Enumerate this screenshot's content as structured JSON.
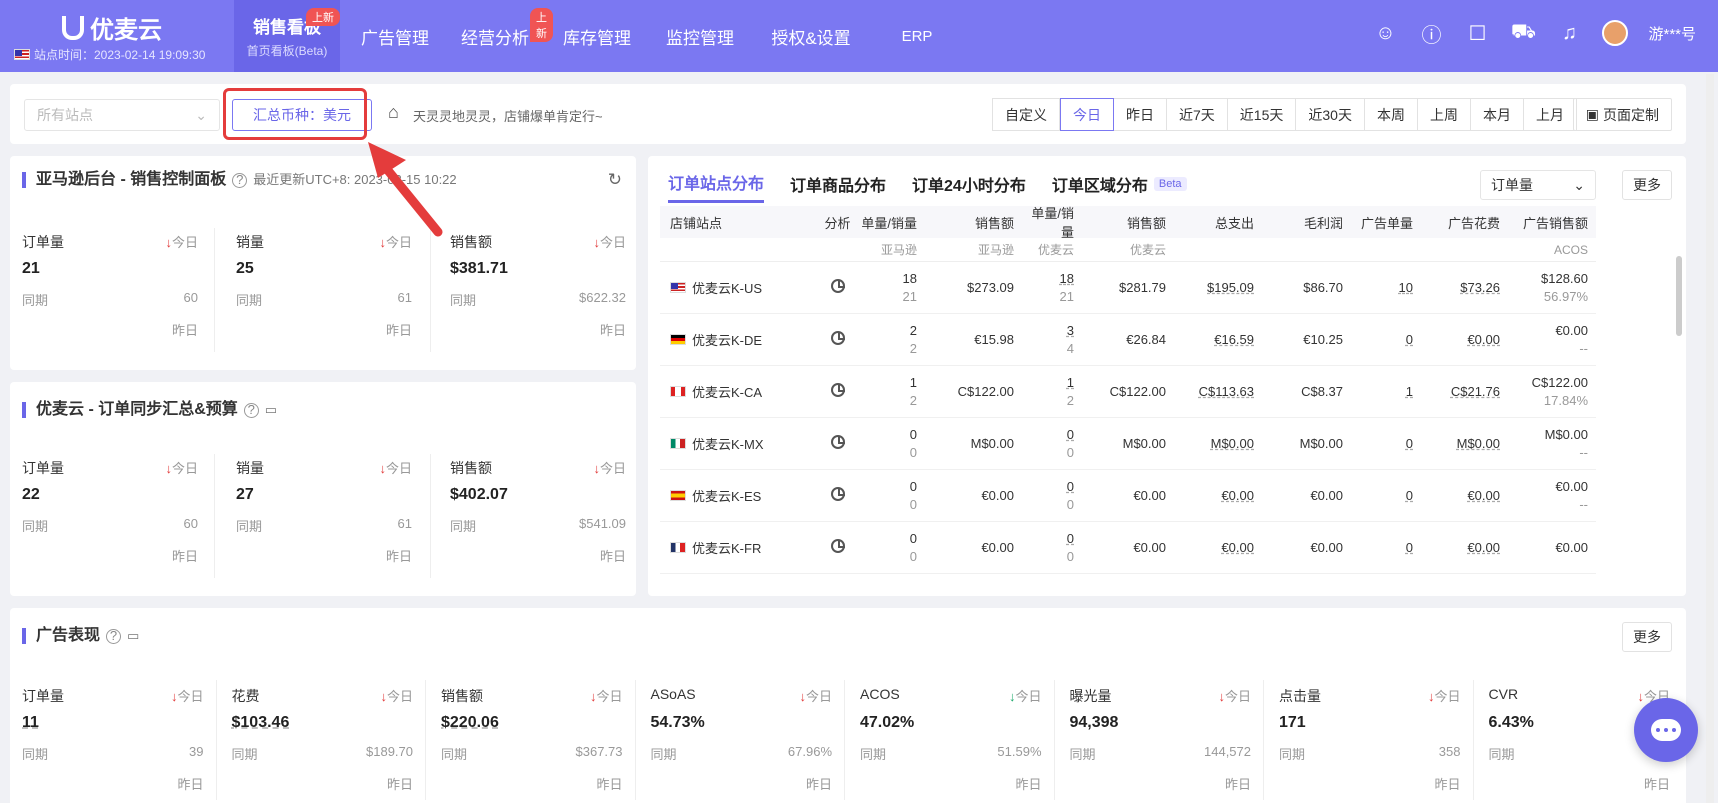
{
  "nav": {
    "logo": "优麦云",
    "site_time": "站点时间：2023-02-14 19:09:30",
    "items": [
      {
        "label": "销售看板",
        "sub": "首页看板(Beta)",
        "badge": "上新"
      },
      {
        "label": "广告管理"
      },
      {
        "label": "经营分析",
        "badge": "上新"
      },
      {
        "label": "库存管理"
      },
      {
        "label": "监控管理"
      },
      {
        "label": "授权&设置"
      },
      {
        "label": "ERP"
      }
    ],
    "user": "游***号"
  },
  "filter": {
    "site_placeholder": "所有站点",
    "currency": "汇总币种：美元",
    "slogan": "天灵灵地灵灵，店铺爆单肯定行~",
    "dates": [
      "自定义",
      "今日",
      "昨日",
      "近7天",
      "近15天",
      "近30天",
      "本周",
      "上周",
      "本月",
      "上月"
    ],
    "active_date": "今日",
    "page_custom": "页面定制"
  },
  "amazon": {
    "title": "亚马逊后台 - 销售控制面板",
    "updated": "最近更新UTC+8: 2023-02-15 10:22",
    "metrics": [
      {
        "label": "订单量",
        "trend": "今日",
        "value": "21",
        "same_label": "同期",
        "same": "60",
        "yest": "昨日"
      },
      {
        "label": "销量",
        "trend": "今日",
        "value": "25",
        "same_label": "同期",
        "same": "61",
        "yest": "昨日"
      },
      {
        "label": "销售额",
        "trend": "今日",
        "value": "$381.71",
        "same_label": "同期",
        "same": "$622.32",
        "yest": "昨日"
      }
    ]
  },
  "sync": {
    "title": "优麦云 - 订单同步汇总&预算",
    "metrics": [
      {
        "label": "订单量",
        "trend": "今日",
        "value": "22",
        "same_label": "同期",
        "same": "60",
        "yest": "昨日"
      },
      {
        "label": "销量",
        "trend": "今日",
        "value": "27",
        "same_label": "同期",
        "same": "61",
        "yest": "昨日"
      },
      {
        "label": "销售额",
        "trend": "今日",
        "value": "$402.07",
        "same_label": "同期",
        "same": "$541.09",
        "yest": "昨日"
      }
    ]
  },
  "orders": {
    "tabs": [
      "订单站点分布",
      "订单商品分布",
      "订单24小时分布",
      "订单区域分布"
    ],
    "beta": "Beta",
    "select": "订单量",
    "more": "更多",
    "headers": [
      "店铺站点",
      "分析",
      "单量/销量",
      "销售额",
      "单量/销量",
      "销售额",
      "总支出",
      "毛利润",
      "广告单量",
      "广告花费",
      "广告销售额"
    ],
    "subheaders": [
      "",
      "",
      "亚马逊",
      "亚马逊",
      "优麦云",
      "优麦云",
      "",
      "",
      "",
      "",
      "ACOS"
    ],
    "rows": [
      {
        "flag": "us",
        "store": "优麦云K-US",
        "q1a": "18",
        "q1b": "21",
        "amz": "$273.09",
        "q2a": "18",
        "q2b": "21",
        "sales": "$281.79",
        "cost": "$195.09",
        "profit": "$86.70",
        "adq": "10",
        "adcost": "$73.26",
        "ads": "$128.60",
        "acos": "56.97%"
      },
      {
        "flag": "de",
        "store": "优麦云K-DE",
        "q1a": "2",
        "q1b": "2",
        "amz": "€15.98",
        "q2a": "3",
        "q2b": "4",
        "sales": "€26.84",
        "cost": "€16.59",
        "profit": "€10.25",
        "adq": "0",
        "adcost": "€0.00",
        "ads": "€0.00",
        "acos": "--"
      },
      {
        "flag": "ca",
        "store": "优麦云K-CA",
        "q1a": "1",
        "q1b": "2",
        "amz": "C$122.00",
        "q2a": "1",
        "q2b": "2",
        "sales": "C$122.00",
        "cost": "C$113.63",
        "profit": "C$8.37",
        "adq": "1",
        "adcost": "C$21.76",
        "ads": "C$122.00",
        "acos": "17.84%"
      },
      {
        "flag": "mx",
        "store": "优麦云K-MX",
        "q1a": "0",
        "q1b": "0",
        "amz": "M$0.00",
        "q2a": "0",
        "q2b": "0",
        "sales": "M$0.00",
        "cost": "M$0.00",
        "profit": "M$0.00",
        "adq": "0",
        "adcost": "M$0.00",
        "ads": "M$0.00",
        "acos": "--"
      },
      {
        "flag": "es",
        "store": "优麦云K-ES",
        "q1a": "0",
        "q1b": "0",
        "amz": "€0.00",
        "q2a": "0",
        "q2b": "0",
        "sales": "€0.00",
        "cost": "€0.00",
        "profit": "€0.00",
        "adq": "0",
        "adcost": "€0.00",
        "ads": "€0.00",
        "acos": "--"
      },
      {
        "flag": "fr",
        "store": "优麦云K-FR",
        "q1a": "0",
        "q1b": "0",
        "amz": "€0.00",
        "q2a": "0",
        "q2b": "0",
        "sales": "€0.00",
        "cost": "€0.00",
        "profit": "€0.00",
        "adq": "0",
        "adcost": "€0.00",
        "ads": "€0.00",
        "acos": ""
      }
    ]
  },
  "ads": {
    "title": "广告表现",
    "more": "更多",
    "metrics": [
      {
        "label": "订单量",
        "trend": "今日",
        "dir": "down",
        "value": "11",
        "same_label": "同期",
        "same": "39",
        "yest": "昨日"
      },
      {
        "label": "花费",
        "trend": "今日",
        "dir": "down",
        "value": "$103.46",
        "same_label": "同期",
        "same": "$189.70",
        "yest": "昨日"
      },
      {
        "label": "销售额",
        "trend": "今日",
        "dir": "down",
        "value": "$220.06",
        "same_label": "同期",
        "same": "$367.73",
        "yest": "昨日"
      },
      {
        "label": "ASoAS",
        "trend": "今日",
        "dir": "down",
        "value": "54.73%",
        "same_label": "同期",
        "same": "67.96%",
        "yest": "昨日"
      },
      {
        "label": "ACOS",
        "trend": "今日",
        "dir": "up",
        "value": "47.02%",
        "same_label": "同期",
        "same": "51.59%",
        "yest": "昨日"
      },
      {
        "label": "曝光量",
        "trend": "今日",
        "dir": "down",
        "value": "94,398",
        "same_label": "同期",
        "same": "144,572",
        "yest": "昨日"
      },
      {
        "label": "点击量",
        "trend": "今日",
        "dir": "down",
        "value": "171",
        "same_label": "同期",
        "same": "358",
        "yest": "昨日"
      },
      {
        "label": "CVR",
        "trend": "今日",
        "dir": "down",
        "value": "6.43%",
        "same_label": "同期",
        "same": "",
        "yest": "昨日"
      }
    ]
  },
  "colors": {
    "brand": "#7b78f2",
    "down": "#e23c3c",
    "up": "#1aa86a",
    "highlight": "#e43c3c"
  }
}
